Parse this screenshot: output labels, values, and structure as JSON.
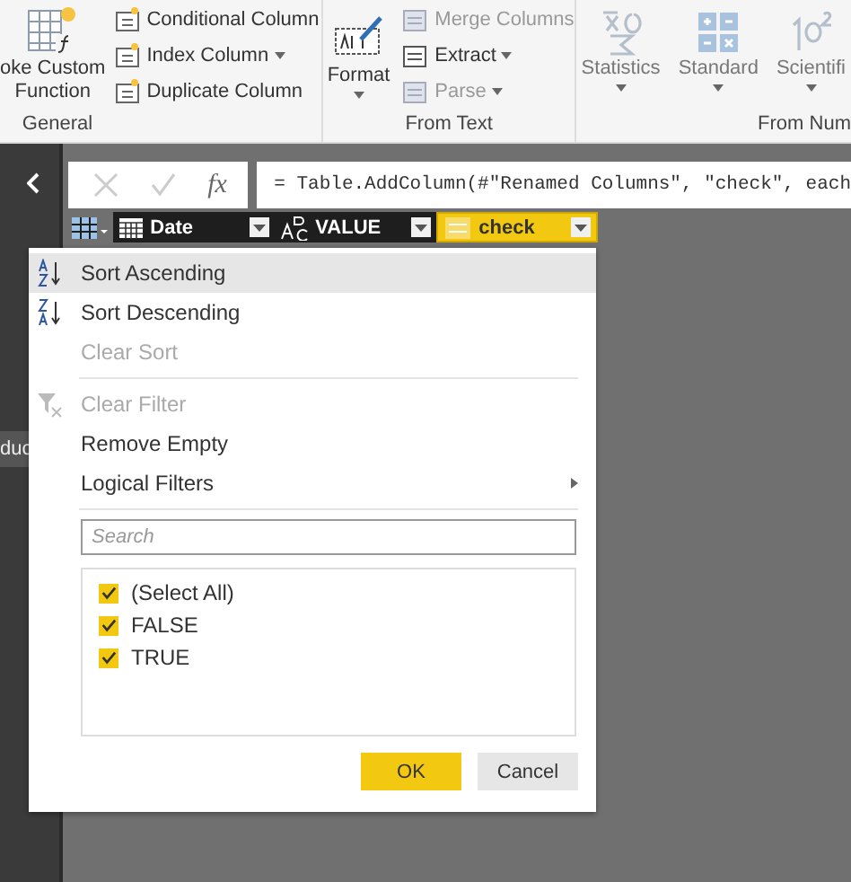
{
  "ribbon": {
    "general": {
      "large_button": [
        "oke Custom",
        "Function"
      ],
      "buttons": [
        {
          "label": "Conditional Column",
          "dropdown": false
        },
        {
          "label": "Index Column",
          "dropdown": true
        },
        {
          "label": "Duplicate Column",
          "dropdown": false
        }
      ],
      "label": "General"
    },
    "from_text": {
      "format": {
        "label": "Format",
        "dropdown": true
      },
      "buttons": [
        {
          "label": "Merge Columns",
          "disabled": true,
          "dropdown": false
        },
        {
          "label": "Extract",
          "disabled": false,
          "dropdown": true
        },
        {
          "label": "Parse",
          "disabled": true,
          "dropdown": true
        }
      ],
      "label": "From Text"
    },
    "from_number": {
      "buttons": [
        {
          "label": "Statistics",
          "disabled": true,
          "dropdown": true
        },
        {
          "label": "Standard",
          "disabled": true,
          "dropdown": true
        },
        {
          "label": "Scientifi",
          "disabled": true,
          "dropdown": true
        }
      ],
      "label": "From Num"
    }
  },
  "sidebar": {
    "item": "duc"
  },
  "formula_bar": {
    "fx_label": "fx",
    "formula": "= Table.AddColumn(#\"Renamed Columns\", \"check\", each"
  },
  "columns": [
    {
      "name": "Date",
      "kind": "date",
      "selected": false
    },
    {
      "name": "VALUE",
      "kind": "text",
      "selected": false
    },
    {
      "name": "check",
      "kind": "any",
      "selected": true
    }
  ],
  "menu": {
    "items": [
      {
        "kind": "sort_asc",
        "label": "Sort Ascending",
        "disabled": false,
        "highlighted": true
      },
      {
        "kind": "sort_desc",
        "label": "Sort Descending",
        "disabled": false,
        "highlighted": false
      },
      {
        "kind": "plain",
        "label": "Clear Sort",
        "disabled": true,
        "highlighted": false
      },
      {
        "kind": "separator"
      },
      {
        "kind": "clear_filter",
        "label": "Clear Filter",
        "disabled": true,
        "highlighted": false
      },
      {
        "kind": "plain",
        "label": "Remove Empty",
        "disabled": false,
        "highlighted": false
      },
      {
        "kind": "submenu",
        "label": "Logical Filters",
        "disabled": false,
        "highlighted": false
      },
      {
        "kind": "separator"
      }
    ],
    "search": {
      "placeholder": "Search"
    },
    "values": [
      {
        "label": "(Select All)",
        "checked": true
      },
      {
        "label": "FALSE",
        "checked": true
      },
      {
        "label": "TRUE",
        "checked": true
      }
    ],
    "buttons": [
      {
        "label": "OK",
        "primary": true
      },
      {
        "label": "Cancel",
        "primary": false
      }
    ]
  }
}
